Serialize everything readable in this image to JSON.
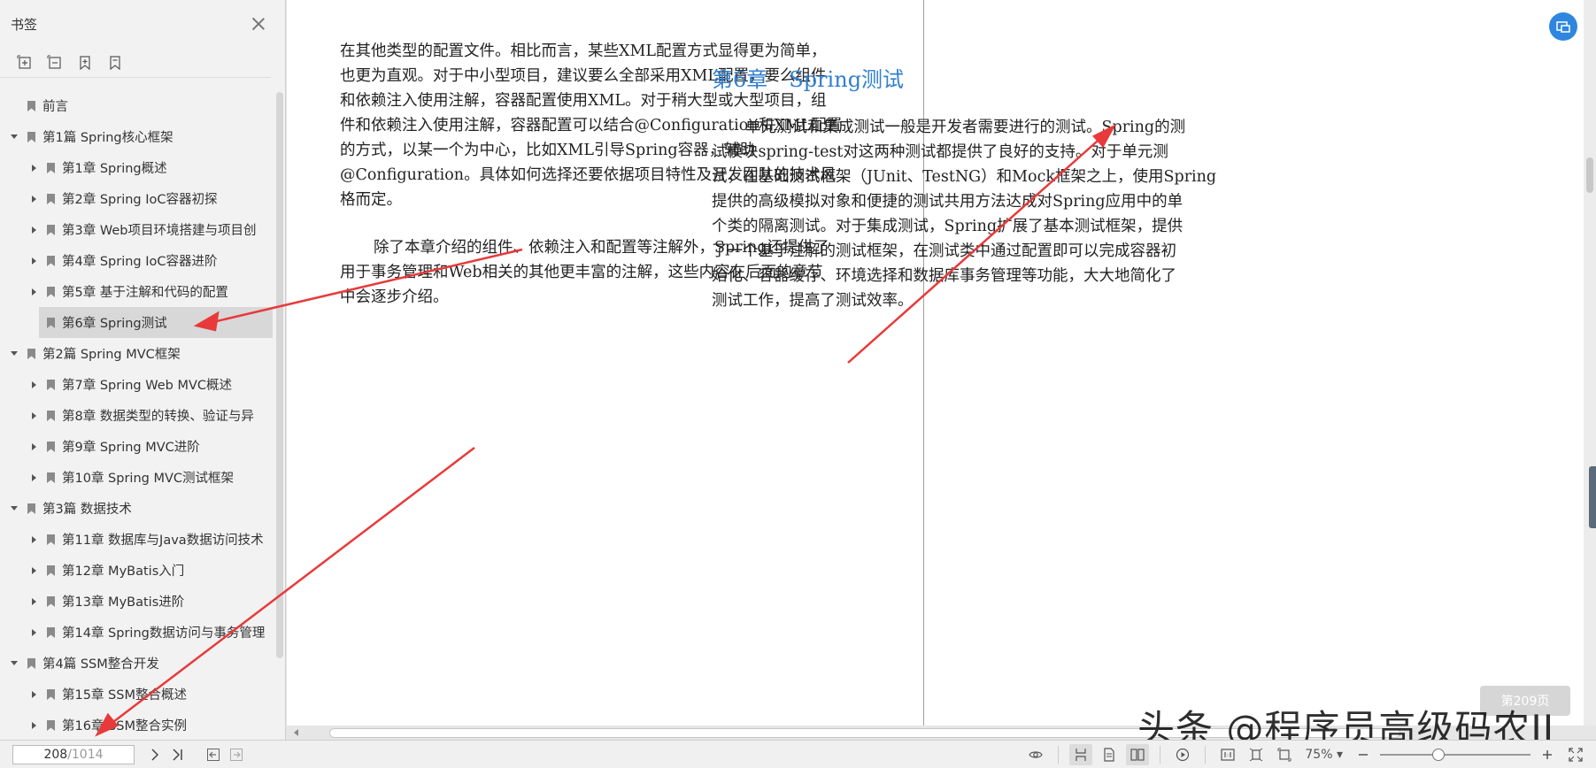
{
  "sidebar": {
    "title": "书签",
    "tools": [
      "expand-all-icon",
      "collapse-all-icon",
      "add-bookmark-icon",
      "bookmark-icon"
    ],
    "items": [
      {
        "label": "前言",
        "level": 0,
        "arrow": "none"
      },
      {
        "label": "第1篇 Spring核心框架",
        "level": 0,
        "arrow": "down"
      },
      {
        "label": "第1章 Spring概述",
        "level": 1,
        "arrow": "right"
      },
      {
        "label": "第2章 Spring IoC容器初探",
        "level": 1,
        "arrow": "right"
      },
      {
        "label": "第3章 Web项目环境搭建与项目创",
        "level": 1,
        "arrow": "right"
      },
      {
        "label": "第4章 Spring IoC容器进阶",
        "level": 1,
        "arrow": "right"
      },
      {
        "label": "第5章 基于注解和代码的配置",
        "level": 1,
        "arrow": "right"
      },
      {
        "label": "第6章 Spring测试",
        "level": 1,
        "arrow": "right",
        "selected": true
      },
      {
        "label": "第2篇 Spring MVC框架",
        "level": 0,
        "arrow": "down"
      },
      {
        "label": "第7章 Spring Web MVC概述",
        "level": 1,
        "arrow": "right"
      },
      {
        "label": "第8章 数据类型的转换、验证与异",
        "level": 1,
        "arrow": "right"
      },
      {
        "label": "第9章 Spring MVC进阶",
        "level": 1,
        "arrow": "right"
      },
      {
        "label": "第10章 Spring MVC测试框架",
        "level": 1,
        "arrow": "right"
      },
      {
        "label": "第3篇 数据技术",
        "level": 0,
        "arrow": "down"
      },
      {
        "label": "第11章 数据库与Java数据访问技术",
        "level": 1,
        "arrow": "right"
      },
      {
        "label": "第12章 MyBatis入门",
        "level": 1,
        "arrow": "right"
      },
      {
        "label": "第13章 MyBatis进阶",
        "level": 1,
        "arrow": "right"
      },
      {
        "label": "第14章 Spring数据访问与事务管理",
        "level": 1,
        "arrow": "right"
      },
      {
        "label": "第4篇 SSM整合开发",
        "level": 0,
        "arrow": "down"
      },
      {
        "label": "第15章 SSM整合概述",
        "level": 1,
        "arrow": "right"
      },
      {
        "label": "第16章 SSM整合实例",
        "level": 1,
        "arrow": "right"
      }
    ]
  },
  "doc": {
    "left_p1": [
      "在其他类型的配置文件。相比而言，某些XML配置方式显得更为简单，",
      "也更为直观。对于中小型项目，建议要么全部采用XML配置，要么组件",
      "和依赖注入使用注解，容器配置使用XML。对于稍大型或大型项目，组",
      "件和依赖注入使用注解，容器配置可以结合@Configuration和XML配置",
      "的方式，以某一个为中心，比如XML引导Spring容器，辅助",
      "@Configuration。具体如何选择还要依据项目特性及开发团队的技术风",
      "格而定。"
    ],
    "left_p2": [
      "除了本章介绍的组件、依赖注入和配置等注解外，Spring还提供了",
      "用于事务管理和Web相关的其他更丰富的注解，这些内容在后面的章节",
      "中会逐步介绍。"
    ],
    "chapter_num": "第6章",
    "chapter_title": "Spring测试",
    "right_p1": [
      "单元测试和集成测试一般是开发者需要进行的测试。Spring的测",
      "试模块spring-test对这两种测试都提供了良好的支持。对于单元测",
      "试，在基础测试框架（JUnit、TestNG）和Mock框架之上，使用Spring",
      "提供的高级模拟对象和便捷的测试共用方法达成对Spring应用中的单",
      "个类的隔离测试。对于集成测试，Spring扩展了基本测试框架，提供",
      "了一个基于注解的测试框架，在测试类中通过配置即可以完成容器初",
      "始化、容器缓存、环境选择和数据库事务管理等功能，大大地简化了",
      "测试工作，提高了测试效率。"
    ],
    "page_badge": "第209页"
  },
  "watermark": "头条 @程序员高级码农II",
  "statusbar": {
    "current_page": "208",
    "total_pages": "/1014",
    "zoom": "75%",
    "zoom_level_fraction": 0.38
  },
  "colors": {
    "heading": "#2f7fd0",
    "arrow": "#e83a3a",
    "accent": "#2e86de"
  }
}
